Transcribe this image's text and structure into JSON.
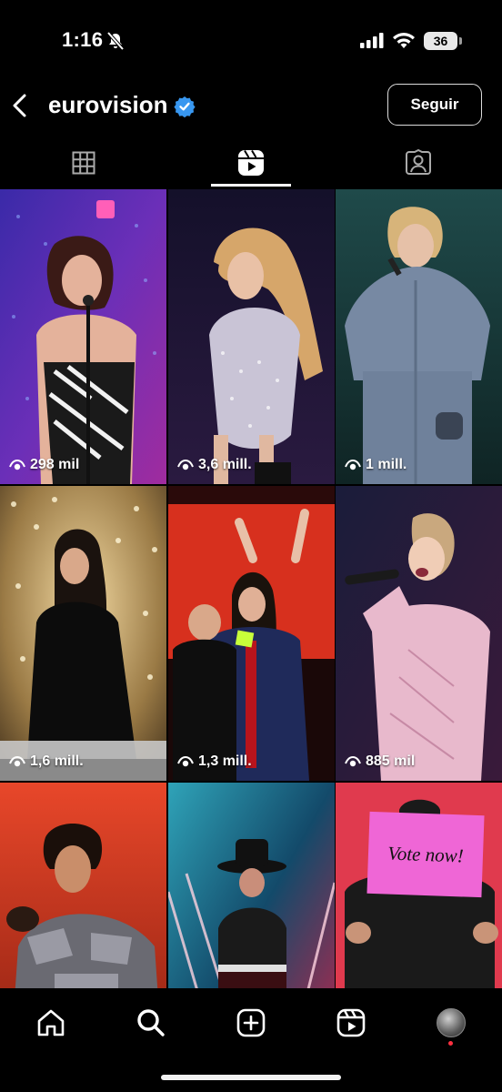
{
  "status_bar": {
    "time": "1:16",
    "battery": "36",
    "icons": [
      "mute-bell-icon",
      "cellular-signal-icon",
      "wifi-icon",
      "battery-icon"
    ]
  },
  "header": {
    "username": "eurovision",
    "verified": true,
    "follow_label": "Seguir",
    "icons": [
      "back-arrow-icon",
      "verified-badge-icon"
    ]
  },
  "tabs": [
    {
      "name": "grid",
      "icon": "grid-icon",
      "active": false
    },
    {
      "name": "reels",
      "icon": "reels-icon",
      "active": true
    },
    {
      "name": "tagged",
      "icon": "tagged-person-icon",
      "active": false
    }
  ],
  "reels": [
    {
      "views": "298 mil"
    },
    {
      "views": "3,6 mill."
    },
    {
      "views": "1 mill."
    },
    {
      "views": "1,6 mill."
    },
    {
      "views": "1,3 mill."
    },
    {
      "views": "885 mil"
    },
    {
      "views": ""
    },
    {
      "views": ""
    },
    {
      "views": "",
      "sign_text": "Vote now!"
    }
  ],
  "bottom_nav": [
    {
      "name": "home",
      "icon": "home-icon"
    },
    {
      "name": "search",
      "icon": "search-icon"
    },
    {
      "name": "create",
      "icon": "add-square-icon"
    },
    {
      "name": "reels",
      "icon": "reels-icon"
    },
    {
      "name": "profile",
      "icon": "avatar"
    }
  ],
  "colors": {
    "background": "#000000",
    "verified_blue": "#3897f0",
    "notification_red": "#ff3040"
  }
}
